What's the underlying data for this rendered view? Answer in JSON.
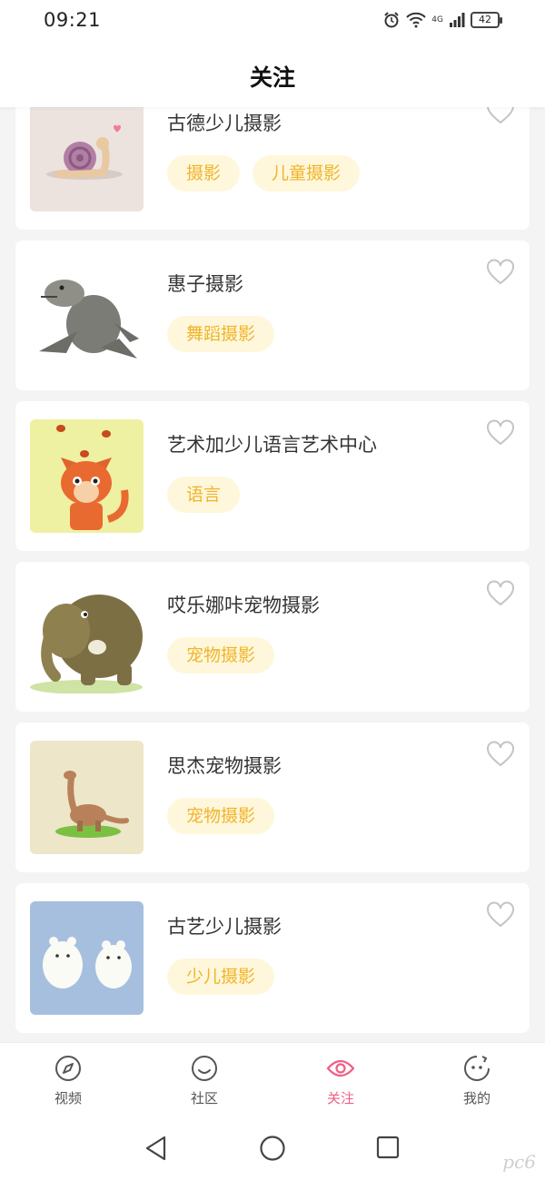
{
  "status_bar": {
    "time": "09:21",
    "network": "4G",
    "battery": "42"
  },
  "header": {
    "title": "关注"
  },
  "cards": [
    {
      "name": "古德少儿摄影",
      "tags": [
        "摄影",
        "儿童摄影"
      ],
      "image": "snail-illustration"
    },
    {
      "name": "惠子摄影",
      "tags": [
        "舞蹈摄影"
      ],
      "image": "sea-lion-illustration"
    },
    {
      "name": "艺术加少儿语言艺术中心",
      "tags": [
        "语言"
      ],
      "image": "fox-illustration"
    },
    {
      "name": "哎乐娜咔宠物摄影",
      "tags": [
        "宠物摄影"
      ],
      "image": "elephant-illustration"
    },
    {
      "name": "思杰宠物摄影",
      "tags": [
        "宠物摄影"
      ],
      "image": "dinosaur-illustration"
    },
    {
      "name": "古艺少儿摄影",
      "tags": [
        "少儿摄影"
      ],
      "image": "polar-bears-illustration"
    }
  ],
  "tab_bar": {
    "tabs": [
      {
        "label": "视频",
        "icon": "compass-icon"
      },
      {
        "label": "社区",
        "icon": "smile-icon"
      },
      {
        "label": "关注",
        "icon": "eye-icon",
        "active": true
      },
      {
        "label": "我的",
        "icon": "face-icon"
      }
    ]
  },
  "colors": {
    "accent": "#ef5f86",
    "tag_text": "#f0b429",
    "tag_bg": "#fff7dc",
    "background": "#f4f4f4"
  },
  "watermark": "pc6"
}
